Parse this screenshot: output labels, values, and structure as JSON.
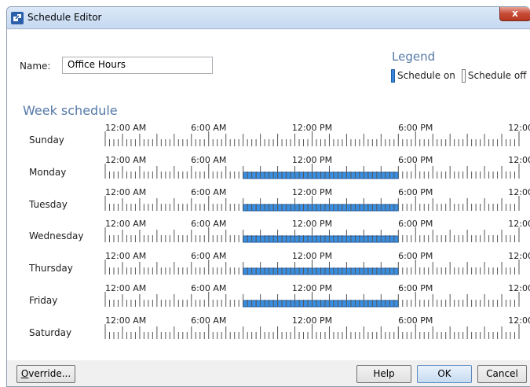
{
  "window": {
    "title": "Schedule Editor",
    "close_glyph": "x"
  },
  "name_field": {
    "label": "Name:",
    "value": "Office Hours"
  },
  "legend": {
    "title": "Legend",
    "on_label": "Schedule on",
    "off_label": "Schedule off",
    "on_color": "#3a8ee0"
  },
  "week_schedule": {
    "title": "Week schedule",
    "time_labels": [
      "12:00 AM",
      "6:00 AM",
      "12:00 PM",
      "6:00 PM",
      "12:00"
    ],
    "days": [
      {
        "name": "Sunday",
        "on": null
      },
      {
        "name": "Monday",
        "on": [
          8,
          17
        ]
      },
      {
        "name": "Tuesday",
        "on": [
          8,
          17
        ]
      },
      {
        "name": "Wednesday",
        "on": [
          8,
          17
        ]
      },
      {
        "name": "Thursday",
        "on": [
          8,
          17
        ]
      },
      {
        "name": "Friday",
        "on": [
          8,
          17
        ]
      },
      {
        "name": "Saturday",
        "on": null
      }
    ]
  },
  "buttons": {
    "override_mnemonic": "O",
    "override_rest": "verride...",
    "help": "Help",
    "ok": "OK",
    "cancel": "Cancel"
  }
}
